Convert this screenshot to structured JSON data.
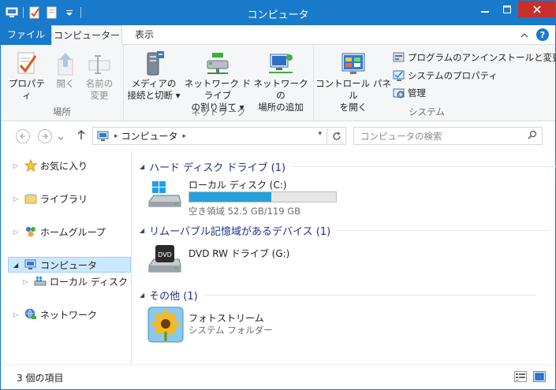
{
  "window": {
    "title": "コンピュータ"
  },
  "qat": {
    "icons": [
      "computer-icon",
      "properties-icon",
      "new-folder-icon",
      "customize-dropdown-icon"
    ]
  },
  "tabs": {
    "file": "ファイル",
    "computer": "コンピューター",
    "view": "表示"
  },
  "ribbon": {
    "location": {
      "title": "場所",
      "properties": "プロパティ",
      "open": "開く",
      "rename_line1": "名前の",
      "rename_line2": "変更"
    },
    "network": {
      "title": "ネットワーク",
      "media_line1": "メディアの",
      "media_line2": "接続と切断",
      "map_line1": "ネットワーク ドライブ",
      "map_line2": "の割り当て",
      "add_line1": "ネットワークの",
      "add_line2": "場所の追加"
    },
    "system": {
      "title": "システム",
      "control_line1": "コントロール パネル",
      "control_line2": "を開く",
      "uninstall": "プログラムのアンインストールと変更",
      "sysprops": "システムのプロパティ",
      "manage": "管理"
    }
  },
  "address": {
    "crumb": "コンピュータ",
    "search_placeholder": "コンピュータの検索"
  },
  "nav": {
    "favorites": "お気に入り",
    "libraries": "ライブラリ",
    "homegroup": "ホームグループ",
    "computer": "コンピュータ",
    "local_disk": "ローカル ディスク (C:)",
    "network": "ネットワーク"
  },
  "content": {
    "hdd_group": "ハード ディスク ドライブ (1)",
    "hdd_name": "ローカル ディスク (C:)",
    "hdd_free": "空き領域 52.5 GB/119 GB",
    "hdd_used_fraction": 0.56,
    "removable_group": "リムーバブル記憶域があるデバイス (1)",
    "dvd_name": "DVD RW ドライブ (G:)",
    "dvd_label": "DVD",
    "other_group": "その他 (1)",
    "photo_name": "フォトストリーム",
    "photo_type": "システム フォルダー"
  },
  "status": {
    "count": "3 個の項目"
  },
  "colors": {
    "accent": "#1979ca",
    "close": "#c7302b",
    "progress": "#26a0da",
    "selection": "#cce8ff",
    "group_header": "#1e3287"
  }
}
